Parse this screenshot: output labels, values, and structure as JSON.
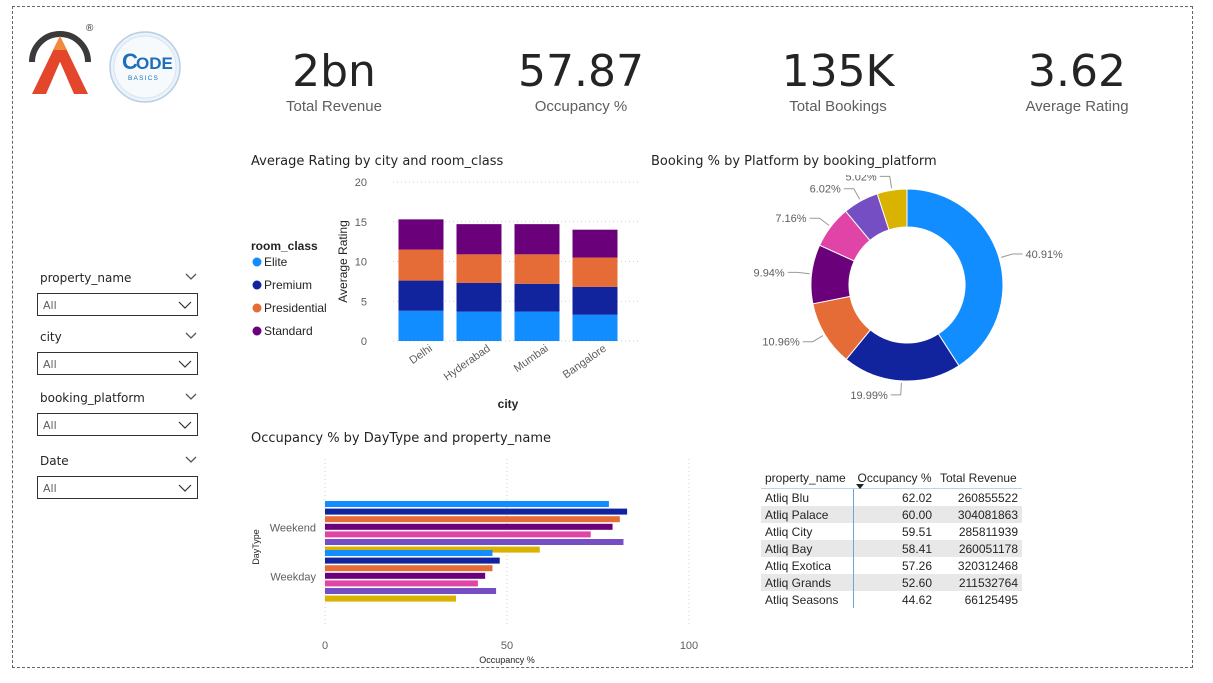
{
  "kpis": [
    {
      "value": "2bn",
      "label": "Total Revenue"
    },
    {
      "value": "57.87",
      "label": "Occupancy %"
    },
    {
      "value": "135K",
      "label": "Total Bookings"
    },
    {
      "value": "3.62",
      "label": "Average Rating"
    }
  ],
  "logos": {
    "atliq_registered": "®",
    "codebasics_top": "ODE",
    "codebasics_bottom": "BASICS"
  },
  "slicers": [
    {
      "label": "property_name",
      "value": "All"
    },
    {
      "label": "city",
      "value": "All"
    },
    {
      "label": "booking_platform",
      "value": "All"
    },
    {
      "label": "Date",
      "value": "All"
    }
  ],
  "colors": {
    "elite": "#118dff",
    "premium": "#12239e",
    "presidential": "#e66c37",
    "standard": "#6b007b",
    "magenta": "#e044a7",
    "purple": "#744ec2",
    "gold": "#d9b300"
  },
  "chart_data": [
    {
      "type": "bar",
      "stacked": true,
      "title": "Average Rating by city and room_class",
      "xlabel": "city",
      "ylabel": "Average Rating",
      "ylim": [
        0,
        20
      ],
      "yticks": [
        "0",
        "5",
        "10",
        "15",
        "20"
      ],
      "legend_title": "room_class",
      "legend_position": "left",
      "categories": [
        "Delhi",
        "Hyderabad",
        "Mumbai",
        "Bangalore"
      ],
      "series": [
        {
          "name": "Elite",
          "color": "#118dff",
          "values": [
            3.8,
            3.7,
            3.7,
            3.3
          ]
        },
        {
          "name": "Premium",
          "color": "#12239e",
          "values": [
            3.8,
            3.6,
            3.5,
            3.5
          ]
        },
        {
          "name": "Presidential",
          "color": "#e66c37",
          "values": [
            3.9,
            3.6,
            3.7,
            3.7
          ]
        },
        {
          "name": "Standard",
          "color": "#6b007b",
          "values": [
            3.8,
            3.8,
            3.8,
            3.5
          ]
        }
      ]
    },
    {
      "type": "pie",
      "donut": true,
      "title": "Booking % by Platform by booking_platform",
      "slices": [
        {
          "value": 40.91,
          "label": "40.91%",
          "color": "#118dff"
        },
        {
          "value": 19.99,
          "label": "19.99%",
          "color": "#12239e"
        },
        {
          "value": 10.96,
          "label": "10.96%",
          "color": "#e66c37"
        },
        {
          "value": 9.94,
          "label": "9.94%",
          "color": "#6b007b"
        },
        {
          "value": 7.16,
          "label": "7.16%",
          "color": "#e044a7"
        },
        {
          "value": 6.02,
          "label": "6.02%",
          "color": "#744ec2"
        },
        {
          "value": 5.02,
          "label": "5.02%",
          "color": "#d9b300"
        }
      ]
    },
    {
      "type": "bar",
      "orientation": "horizontal",
      "title": "Occupancy % by DayType and property_name",
      "xlabel": "Occupancy %",
      "ylabel": "DayType",
      "xlim": [
        0,
        100
      ],
      "xticks": [
        "0",
        "50",
        "100"
      ],
      "categories": [
        "Weekend",
        "Weekday"
      ],
      "series": [
        {
          "color": "#118dff",
          "values": [
            78,
            46
          ]
        },
        {
          "color": "#12239e",
          "values": [
            83,
            48
          ]
        },
        {
          "color": "#e66c37",
          "values": [
            81,
            46
          ]
        },
        {
          "color": "#6b007b",
          "values": [
            79,
            44
          ]
        },
        {
          "color": "#e044a7",
          "values": [
            73,
            42
          ]
        },
        {
          "color": "#744ec2",
          "values": [
            82,
            47
          ]
        },
        {
          "color": "#d9b300",
          "values": [
            59,
            36
          ]
        }
      ]
    },
    {
      "type": "table",
      "columns": [
        "property_name",
        "Occupancy %",
        "Total Revenue"
      ],
      "rows": [
        [
          "Atliq Blu",
          "62.02",
          "260855522"
        ],
        [
          "Atliq Palace",
          "60.00",
          "304081863"
        ],
        [
          "Atliq City",
          "59.51",
          "285811939"
        ],
        [
          "Atliq Bay",
          "58.41",
          "260051178"
        ],
        [
          "Atliq Exotica",
          "57.26",
          "320312468"
        ],
        [
          "Atliq Grands",
          "52.60",
          "211532764"
        ],
        [
          "Atliq Seasons",
          "44.62",
          "66125495"
        ]
      ]
    }
  ]
}
